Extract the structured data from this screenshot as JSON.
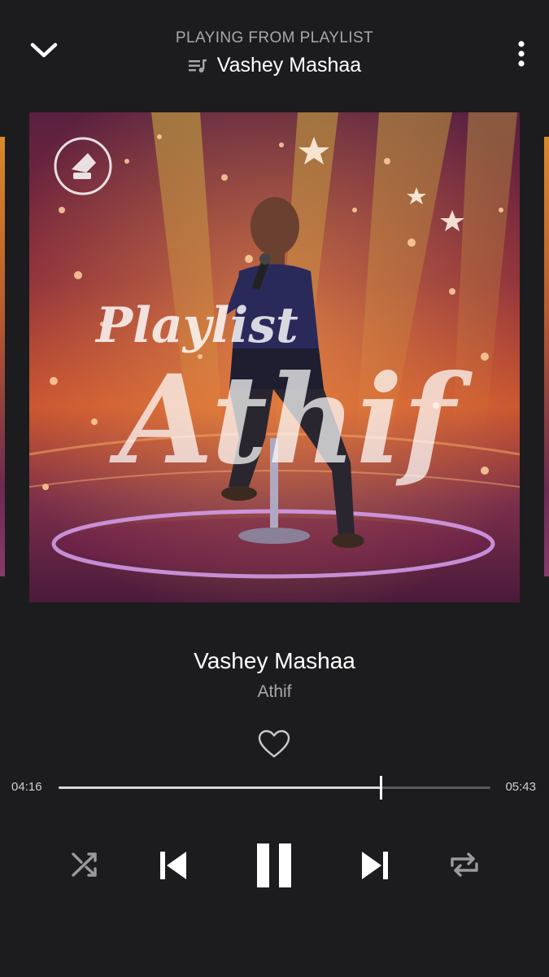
{
  "header": {
    "context_label": "PLAYING FROM PLAYLIST",
    "playlist_name": "Vashey Mashaa",
    "collapse_icon": "chevron-down-icon",
    "playlist_icon": "queue-music-icon",
    "more_icon": "more-vert-icon"
  },
  "artwork": {
    "title_line1": "Playlist",
    "title_line2": "Athif"
  },
  "track": {
    "title": "Vashey Mashaa",
    "artist": "Athif",
    "liked": false
  },
  "progress": {
    "elapsed": "04:16",
    "total": "05:43",
    "fraction": 0.746
  },
  "controls": {
    "shuffle_icon": "shuffle-icon",
    "previous_icon": "skip-previous-icon",
    "play_state": "playing",
    "pause_icon": "pause-icon",
    "next_icon": "skip-next-icon",
    "repeat_icon": "repeat-icon"
  },
  "colors": {
    "background": "#1c1c1e",
    "primary_text": "#ffffff",
    "secondary_text": "#a8a8ac"
  }
}
